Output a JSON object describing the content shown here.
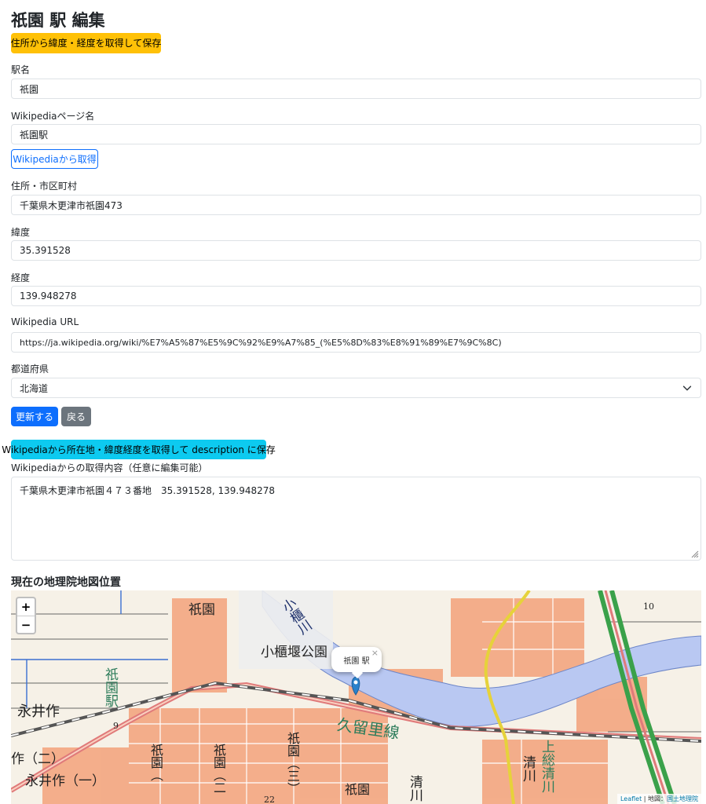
{
  "page": {
    "title": "祇園 駅 編集"
  },
  "actions": {
    "geocode_save": "住所から緯度・経度を取得して保存",
    "wiki_fetch": "Wikipediaから取得",
    "update": "更新する",
    "back": "戻る",
    "wiki_location_save": "Wikipediaから所在地・緯度経度を取得して description に保存"
  },
  "fields": {
    "station_name": {
      "label": "駅名",
      "value": "祇園"
    },
    "wiki_page": {
      "label": "Wikipediaページ名",
      "value": "祇園駅"
    },
    "address": {
      "label": "住所・市区町村",
      "value": "千葉県木更津市祇園473"
    },
    "latitude": {
      "label": "緯度",
      "value": "35.391528"
    },
    "longitude": {
      "label": "経度",
      "value": "139.948278"
    },
    "wiki_url": {
      "label": "Wikipedia URL",
      "value": "https://ja.wikipedia.org/wiki/%E7%A5%87%E5%9C%92%E9%A7%85_(%E5%8D%83%E8%91%89%E7%9C%8C)"
    },
    "prefecture": {
      "label": "都道府県",
      "value": "北海道"
    },
    "wiki_content": {
      "label": "Wikipediaからの取得内容（任意に編集可能）",
      "value": "千葉県木更津市祇園４７３番地　35.391528, 139.948278"
    }
  },
  "map": {
    "heading": "現在の地理院地図位置",
    "zoom_in": "+",
    "zoom_out": "−",
    "popup": "祇園 駅",
    "popup_close": "×",
    "attribution_leaflet": "Leaflet",
    "attribution_sep": " | 地図：",
    "attribution_gsi": "国土地理院",
    "labels": {
      "kogurigawa": "小櫃川",
      "park": "小櫃堰公園",
      "line": "久留里線",
      "gion_top": "祇園",
      "gion_station": "祇園駅",
      "nagaisaku": "永井作",
      "nagaisaku_2": "作（二）",
      "nagaisaku_1": "永井作（一）",
      "gion_block_a": "祇園（",
      "gion_block_b": "祇園（二",
      "gion_block_c": "祇園（三）",
      "gion_block_d": "祇園",
      "kiyokawa": "清川",
      "kiyokawa2": "清川",
      "kazusa_kiyokawa": "上総清川",
      "num_9": "9",
      "num_10": "10",
      "num_22": "22"
    }
  },
  "colors": {
    "primary": "#0d6efd",
    "warning": "#ffc107",
    "info": "#0dcaf0",
    "secondary": "#6c757d",
    "river": "#b9c8f2",
    "rail": "#555555",
    "road_red": "#e07a7a",
    "expressway": "#3aa14a"
  }
}
